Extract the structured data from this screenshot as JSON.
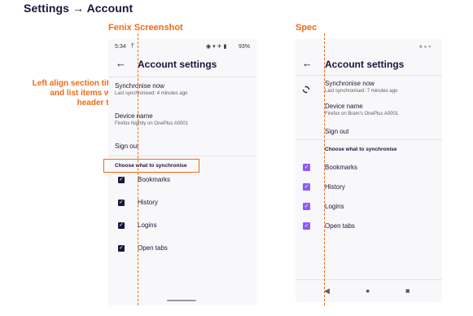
{
  "page": {
    "title": "Settings → Account"
  },
  "note": {
    "text_lines": [
      "Left align section titles",
      "and list items with",
      "header text"
    ]
  },
  "left": {
    "heading": "Fenix Screenshot",
    "status": {
      "time": "5:34",
      "battery": "93%"
    },
    "appbar_title": "Account settings",
    "back_icon": "←",
    "items": [
      {
        "title": "Synchronise now",
        "subtitle": "Last synchronised: 4 minutes ago"
      },
      {
        "title": "Device name",
        "subtitle": "Firefox Nightly on OnePlus A0001"
      },
      {
        "title": "Sign out"
      }
    ],
    "section_title": "Choose what to synchronise",
    "checkboxes": [
      {
        "label": "Bookmarks",
        "checked": true
      },
      {
        "label": "History",
        "checked": true
      },
      {
        "label": "Logins",
        "checked": true
      },
      {
        "label": "Open tabs",
        "checked": true
      }
    ]
  },
  "right": {
    "heading": "Spec",
    "appbar_title": "Account settings",
    "back_icon": "←",
    "items": [
      {
        "title": "Synchronise now",
        "subtitle": "Last synchronised: 7 minutes ago"
      },
      {
        "title": "Device name",
        "subtitle": "Firefox on Bram's OnePlus A0001"
      },
      {
        "title": "Sign out"
      }
    ],
    "section_title": "Choose what to synchronise",
    "checkboxes": [
      {
        "label": "Bookmarks",
        "checked": true
      },
      {
        "label": "History",
        "checked": true
      },
      {
        "label": "Logins",
        "checked": true
      },
      {
        "label": "Open tabs",
        "checked": true
      }
    ]
  },
  "icons": {
    "sync": "sync-icon",
    "check": "✓",
    "nav_back": "◀",
    "nav_home": "●",
    "nav_recent": "■"
  },
  "colors": {
    "accent": "#f06a16",
    "ink": "#20123a",
    "checkbox_purple": "#9059ff",
    "phone_bg": "#f8f8fa"
  }
}
